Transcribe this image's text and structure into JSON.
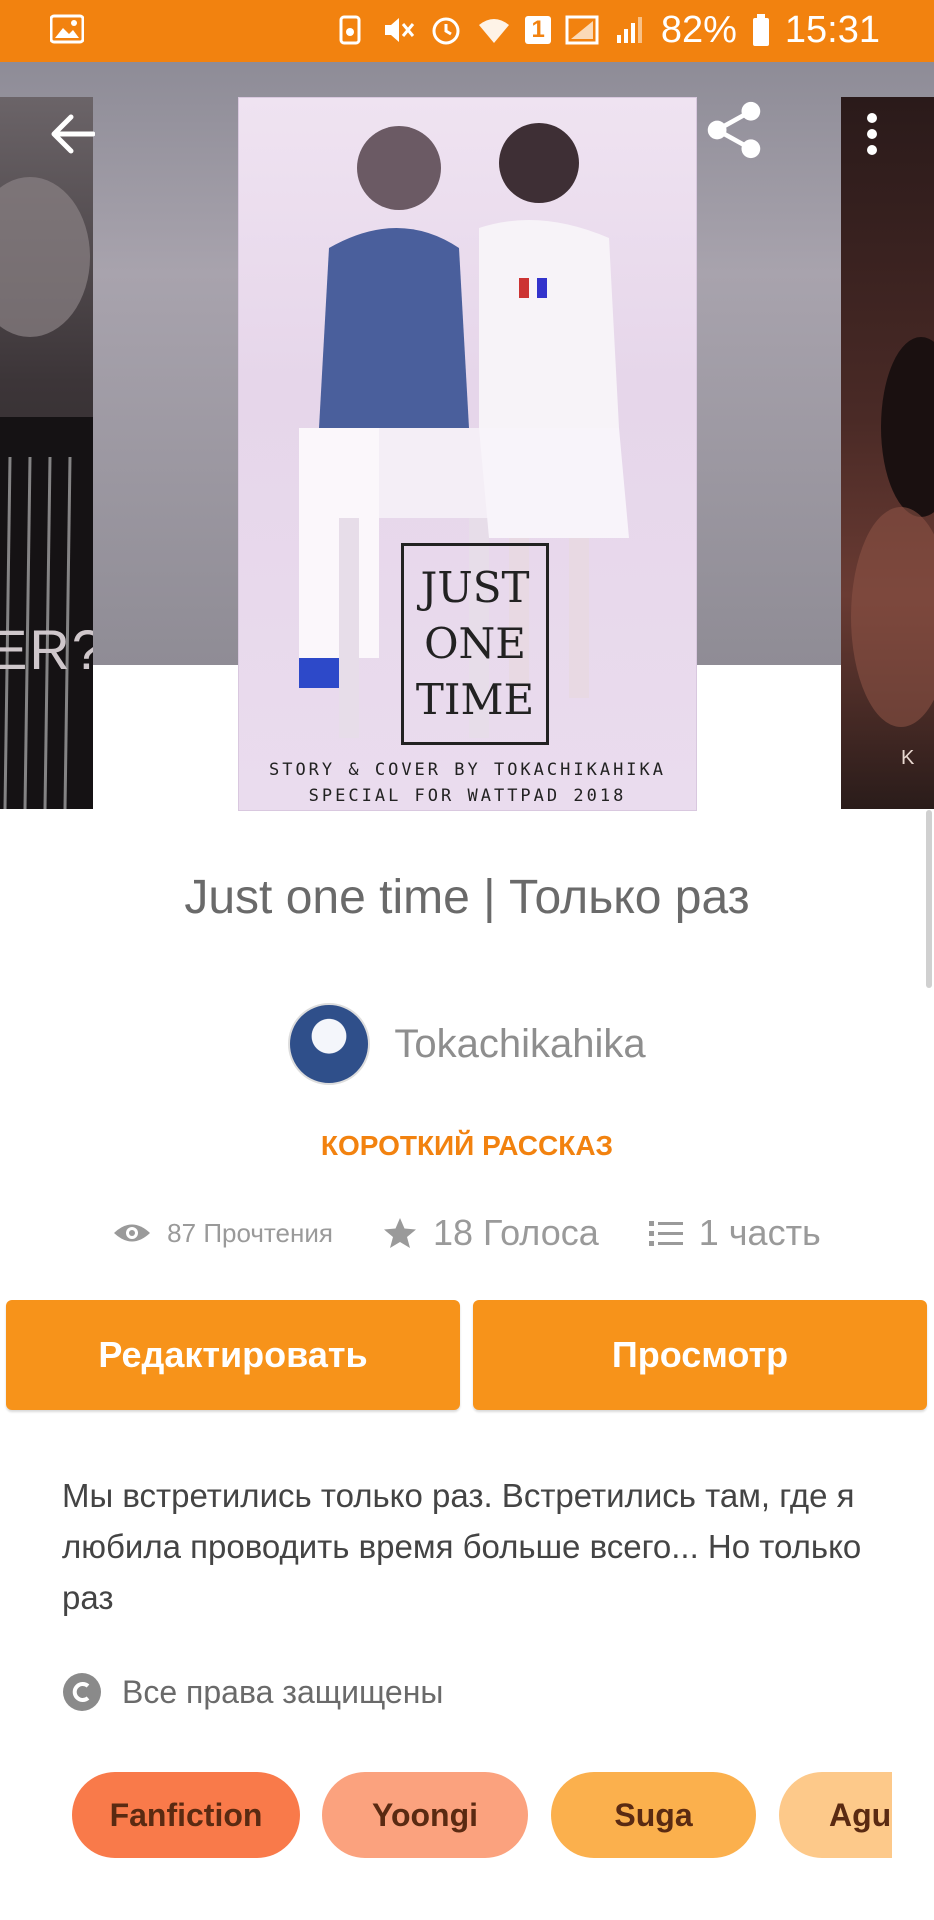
{
  "status_bar": {
    "battery": "82%",
    "time": "15:31",
    "sim_label": "1"
  },
  "covers": {
    "left_partial_text": "ER?",
    "right_partial_text": "K",
    "main_box_lines": [
      "JUST",
      "ONE",
      "TIME"
    ],
    "main_credit_1": "STORY & COVER BY TOKACHIKAHIKA",
    "main_credit_2": "SPECIAL FOR WATTPAD 2018"
  },
  "story": {
    "title": "Just one time | Только раз",
    "author": "Tokachikahika",
    "category": "КОРОТКИЙ РАССКАЗ",
    "reads": "87 Прочтения",
    "votes": "18 Голоса",
    "parts": "1 часть",
    "description": "Мы встретились только раз. Встретились там, где я любила проводить время больше всего... Но только раз",
    "rights": "Все права защищены"
  },
  "actions": {
    "edit_label": "Редактировать",
    "view_label": "Просмотр"
  },
  "tags": [
    {
      "label": "Fanfiction",
      "color": "#f97a4a"
    },
    {
      "label": "Yoongi",
      "color": "#fba27e"
    },
    {
      "label": "Suga",
      "color": "#fbb04d"
    },
    {
      "label": "Agust",
      "color": "#fdc98a"
    }
  ],
  "icons": {
    "back": "arrow-left-icon",
    "share": "share-icon",
    "more": "more-vert-icon",
    "eye": "eye-icon",
    "star": "star-icon",
    "list": "list-icon",
    "copyright": "copyright-icon"
  },
  "colors": {
    "accent": "#f2820f",
    "button": "#f7931a"
  }
}
